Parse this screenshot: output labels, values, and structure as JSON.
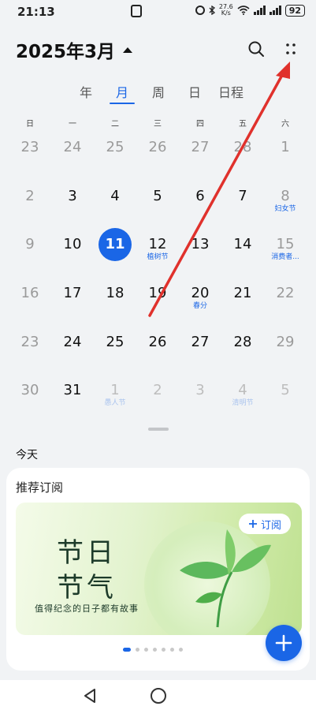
{
  "status_bar": {
    "time": "21:13",
    "network_speed_value": "27.6",
    "network_speed_unit": "K/s",
    "battery": "92"
  },
  "header": {
    "month_title": "2025年3月"
  },
  "view_tabs": [
    {
      "label": "年",
      "active": false
    },
    {
      "label": "月",
      "active": true
    },
    {
      "label": "周",
      "active": false
    },
    {
      "label": "日",
      "active": false
    },
    {
      "label": "日程",
      "active": false
    }
  ],
  "weekdays": [
    "日",
    "一",
    "二",
    "三",
    "四",
    "五",
    "六"
  ],
  "weeks": [
    [
      {
        "n": "23",
        "s": "",
        "state": "muted"
      },
      {
        "n": "24",
        "s": "",
        "state": "muted"
      },
      {
        "n": "25",
        "s": "",
        "state": "muted"
      },
      {
        "n": "26",
        "s": "",
        "state": "muted"
      },
      {
        "n": "27",
        "s": "",
        "state": "muted"
      },
      {
        "n": "28",
        "s": "",
        "state": "muted"
      },
      {
        "n": "1",
        "s": "",
        "state": "muted"
      }
    ],
    [
      {
        "n": "2",
        "s": "",
        "state": "muted"
      },
      {
        "n": "3",
        "s": "",
        "state": "normal"
      },
      {
        "n": "4",
        "s": "",
        "state": "normal"
      },
      {
        "n": "5",
        "s": "",
        "state": "normal"
      },
      {
        "n": "6",
        "s": "",
        "state": "normal"
      },
      {
        "n": "7",
        "s": "",
        "state": "normal"
      },
      {
        "n": "8",
        "s": "妇女节",
        "state": "muted"
      }
    ],
    [
      {
        "n": "9",
        "s": "",
        "state": "muted"
      },
      {
        "n": "10",
        "s": "",
        "state": "normal"
      },
      {
        "n": "11",
        "s": "",
        "state": "today"
      },
      {
        "n": "12",
        "s": "植树节",
        "state": "normal"
      },
      {
        "n": "13",
        "s": "",
        "state": "normal"
      },
      {
        "n": "14",
        "s": "",
        "state": "normal"
      },
      {
        "n": "15",
        "s": "消费者...",
        "state": "muted"
      }
    ],
    [
      {
        "n": "16",
        "s": "",
        "state": "muted"
      },
      {
        "n": "17",
        "s": "",
        "state": "normal"
      },
      {
        "n": "18",
        "s": "",
        "state": "normal"
      },
      {
        "n": "19",
        "s": "",
        "state": "normal"
      },
      {
        "n": "20",
        "s": "春分",
        "state": "normal"
      },
      {
        "n": "21",
        "s": "",
        "state": "normal"
      },
      {
        "n": "22",
        "s": "",
        "state": "muted"
      }
    ],
    [
      {
        "n": "23",
        "s": "",
        "state": "muted"
      },
      {
        "n": "24",
        "s": "",
        "state": "normal"
      },
      {
        "n": "25",
        "s": "",
        "state": "normal"
      },
      {
        "n": "26",
        "s": "",
        "state": "normal"
      },
      {
        "n": "27",
        "s": "",
        "state": "normal"
      },
      {
        "n": "28",
        "s": "",
        "state": "normal"
      },
      {
        "n": "29",
        "s": "",
        "state": "muted"
      }
    ],
    [
      {
        "n": "30",
        "s": "",
        "state": "muted"
      },
      {
        "n": "31",
        "s": "",
        "state": "normal"
      },
      {
        "n": "1",
        "s": "愚人节",
        "state": "faded"
      },
      {
        "n": "2",
        "s": "",
        "state": "faded"
      },
      {
        "n": "3",
        "s": "",
        "state": "faded"
      },
      {
        "n": "4",
        "s": "清明节",
        "state": "faded"
      },
      {
        "n": "5",
        "s": "",
        "state": "faded"
      }
    ]
  ],
  "today_label": "今天",
  "card": {
    "title": "推荐订阅",
    "subscribe_label": "订阅",
    "banner_line1": "节日",
    "banner_line2": "节气",
    "banner_tagline": "值得纪念的日子都有故事",
    "page_count": 7,
    "active_page": 0
  },
  "colors": {
    "accent": "#1a66e6",
    "annotation_arrow": "#e0312c"
  },
  "icons": {
    "search": "search-icon",
    "more": "more-icon",
    "add": "add-icon",
    "back": "back-triangle-icon",
    "home": "home-circle-icon"
  }
}
